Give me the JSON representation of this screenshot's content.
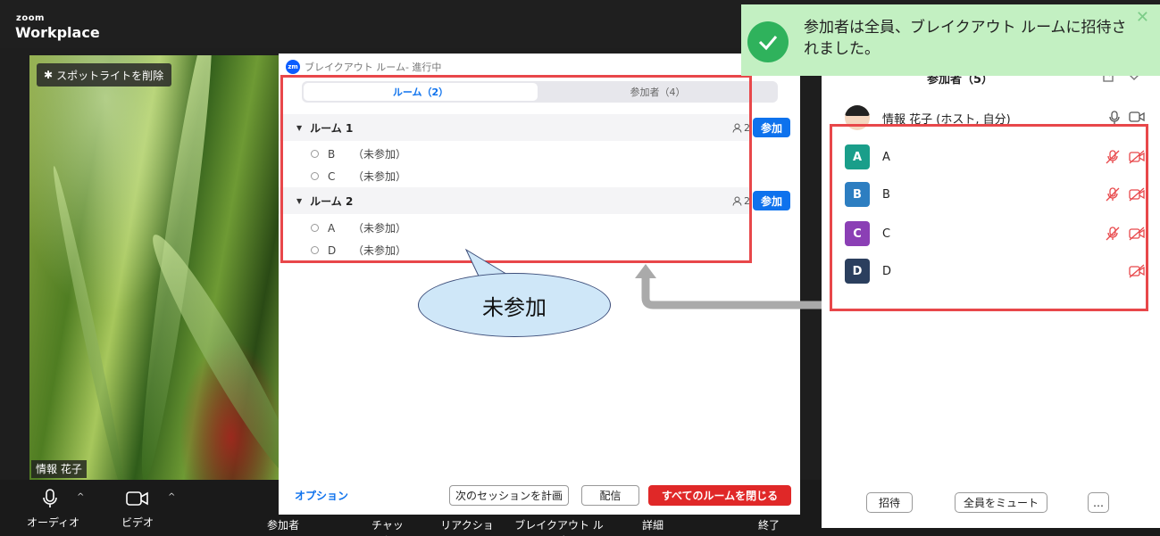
{
  "app": {
    "logo_top": "zoom",
    "logo_bottom": "Workplace"
  },
  "video": {
    "spotlight_label": "スポットライトを削除",
    "name_tag": "情報 花子"
  },
  "toolbar": {
    "audio": "オーディオ",
    "video": "ビデオ",
    "participants": "参加者",
    "chat": "チャット",
    "reactions": "リアクション",
    "breakout": "ブレイクアウト ルーム",
    "details": "詳細",
    "end": "終了"
  },
  "breakout": {
    "title": "ブレイクアウト ルーム- 進行中",
    "tabs": {
      "rooms": "ルーム（2）",
      "participants": "参加者（4）"
    },
    "rooms": [
      {
        "name": "ルーム 1",
        "count": "2",
        "join": "参加",
        "members": [
          {
            "name": "B",
            "status": "（未参加）"
          },
          {
            "name": "C",
            "status": "（未参加）"
          }
        ]
      },
      {
        "name": "ルーム 2",
        "count": "2",
        "join": "参加",
        "members": [
          {
            "name": "A",
            "status": "（未参加）"
          },
          {
            "name": "D",
            "status": "（未参加）"
          }
        ]
      }
    ],
    "options": "オプション",
    "plan_next": "次のセッションを計画",
    "broadcast": "配信",
    "close_all": "すべてのルームを閉じる"
  },
  "callout": {
    "text": "未参加"
  },
  "participants_panel": {
    "title": "参加者（5）",
    "host": {
      "name": "情報 花子 (ホスト, 自分)"
    },
    "list": [
      {
        "initial": "A",
        "name": "A",
        "color": "#1a9e8a"
      },
      {
        "initial": "B",
        "name": "B",
        "color": "#2d7ec1"
      },
      {
        "initial": "C",
        "name": "C",
        "color": "#8b3fb5"
      },
      {
        "initial": "D",
        "name": "D",
        "color": "#2b3f5e"
      }
    ],
    "invite": "招待",
    "mute_all": "全員をミュート",
    "more": "…"
  },
  "toast": {
    "message": "参加者は全員、ブレイクアウト ルームに招待されました。"
  },
  "colors": {
    "accent": "#0e72ed",
    "highlight": "#e8474a",
    "danger": "#e02828"
  }
}
